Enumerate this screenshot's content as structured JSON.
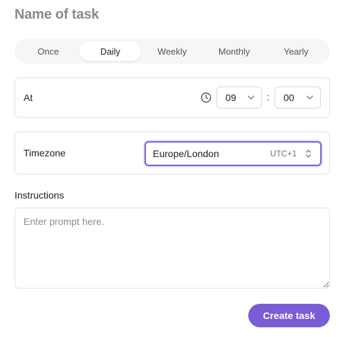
{
  "task": {
    "title": "Name of task"
  },
  "schedule": {
    "tabs": [
      {
        "label": "Once",
        "active": false
      },
      {
        "label": "Daily",
        "active": true
      },
      {
        "label": "Weekly",
        "active": false
      },
      {
        "label": "Monthly",
        "active": false
      },
      {
        "label": "Yearly",
        "active": false
      }
    ]
  },
  "at": {
    "label": "At",
    "icon": "clock-icon",
    "hour": "09",
    "separator": ":",
    "minute": "00"
  },
  "timezone": {
    "label": "Timezone",
    "value": "Europe/London",
    "offset": "UTC+1"
  },
  "instructions": {
    "label": "Instructions",
    "placeholder": "Enter prompt here."
  },
  "actions": {
    "create_label": "Create task"
  },
  "colors": {
    "accent": "#7b5cd6",
    "title": "#8a8a8a",
    "border": "#e2e2e2"
  }
}
